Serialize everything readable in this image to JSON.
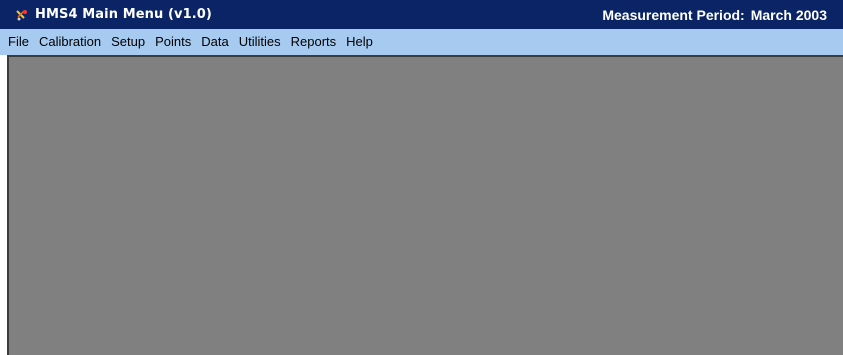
{
  "window": {
    "title": "HMS4 Main Menu (v1.0)",
    "icon": "app-icon",
    "colors": {
      "titlebar": "#0a2466",
      "menubar": "#a6caf0",
      "client_area": "#808080"
    }
  },
  "status": {
    "period_label": "Measurement Period:",
    "period_value": "March 2003"
  },
  "menu": {
    "items": [
      {
        "label": "File"
      },
      {
        "label": "Calibration"
      },
      {
        "label": "Setup"
      },
      {
        "label": "Points"
      },
      {
        "label": "Data"
      },
      {
        "label": "Utilities"
      },
      {
        "label": "Reports"
      },
      {
        "label": "Help"
      }
    ]
  }
}
